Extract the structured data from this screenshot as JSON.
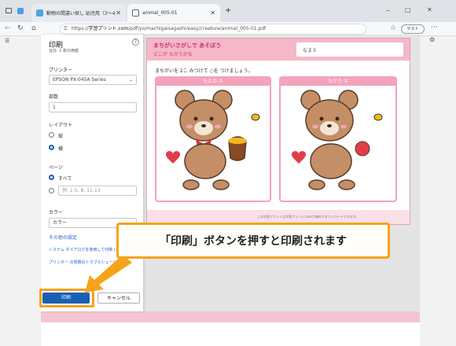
{
  "browser": {
    "tab_inactive_label": "動物の間違い探し 幼児用（3～4）",
    "tab_active_label": "animal_005-01",
    "url_prefix": "https://",
    "url_host": "学習プリント.com",
    "url_path": "/pdf/yo/machigaisagashi/easy/creature/animal_005-01.pdf",
    "profile_label": "ゲスト",
    "new_tab": "+",
    "window_min": "－",
    "window_max": "□",
    "window_close": "✕"
  },
  "print_dialog": {
    "title": "印刷",
    "subtitle": "合計: 1 枚の用紙",
    "help": "?",
    "printer_label": "プリンター",
    "printer_value": "EPSON PX-045A Series",
    "copies_label": "部数",
    "copies_value": "1",
    "layout_label": "レイアウト",
    "layout_options": [
      "縦",
      "横"
    ],
    "pages_label": "ページ",
    "pages_all": "すべて",
    "pages_range_placeholder": "例: 1-5, 8, 11-13",
    "color_label": "カラー",
    "color_value": "カラー",
    "more_settings": "その他の設定",
    "system_dialog_link": "システム ダイアログを使用して印刷 (Ctrl+Shift+P)",
    "troubleshoot_link": "プリンター の問題のトラブルシューティング",
    "print_button": "印刷",
    "cancel_button": "キャンセル"
  },
  "preview": {
    "heading_line1": "まちがいさがしで あそぼう",
    "heading_line2": "どこが ちがうかな",
    "name_label": "なまえ",
    "instruction": "まちがいを 2こ みつけて ○を つけましょう。",
    "left_frame_label": "もとの え",
    "right_frame_label": "ちがう え",
    "footer_text": "この学習プリントは学習プリント.comで無料でダウンロードできます。"
  },
  "callout": {
    "text": "「印刷」ボタンを押すと印刷されます"
  },
  "colors": {
    "accent_blue": "#1a5fb4",
    "highlight_orange": "#f5a31a",
    "pink": "#f3a3ba"
  }
}
